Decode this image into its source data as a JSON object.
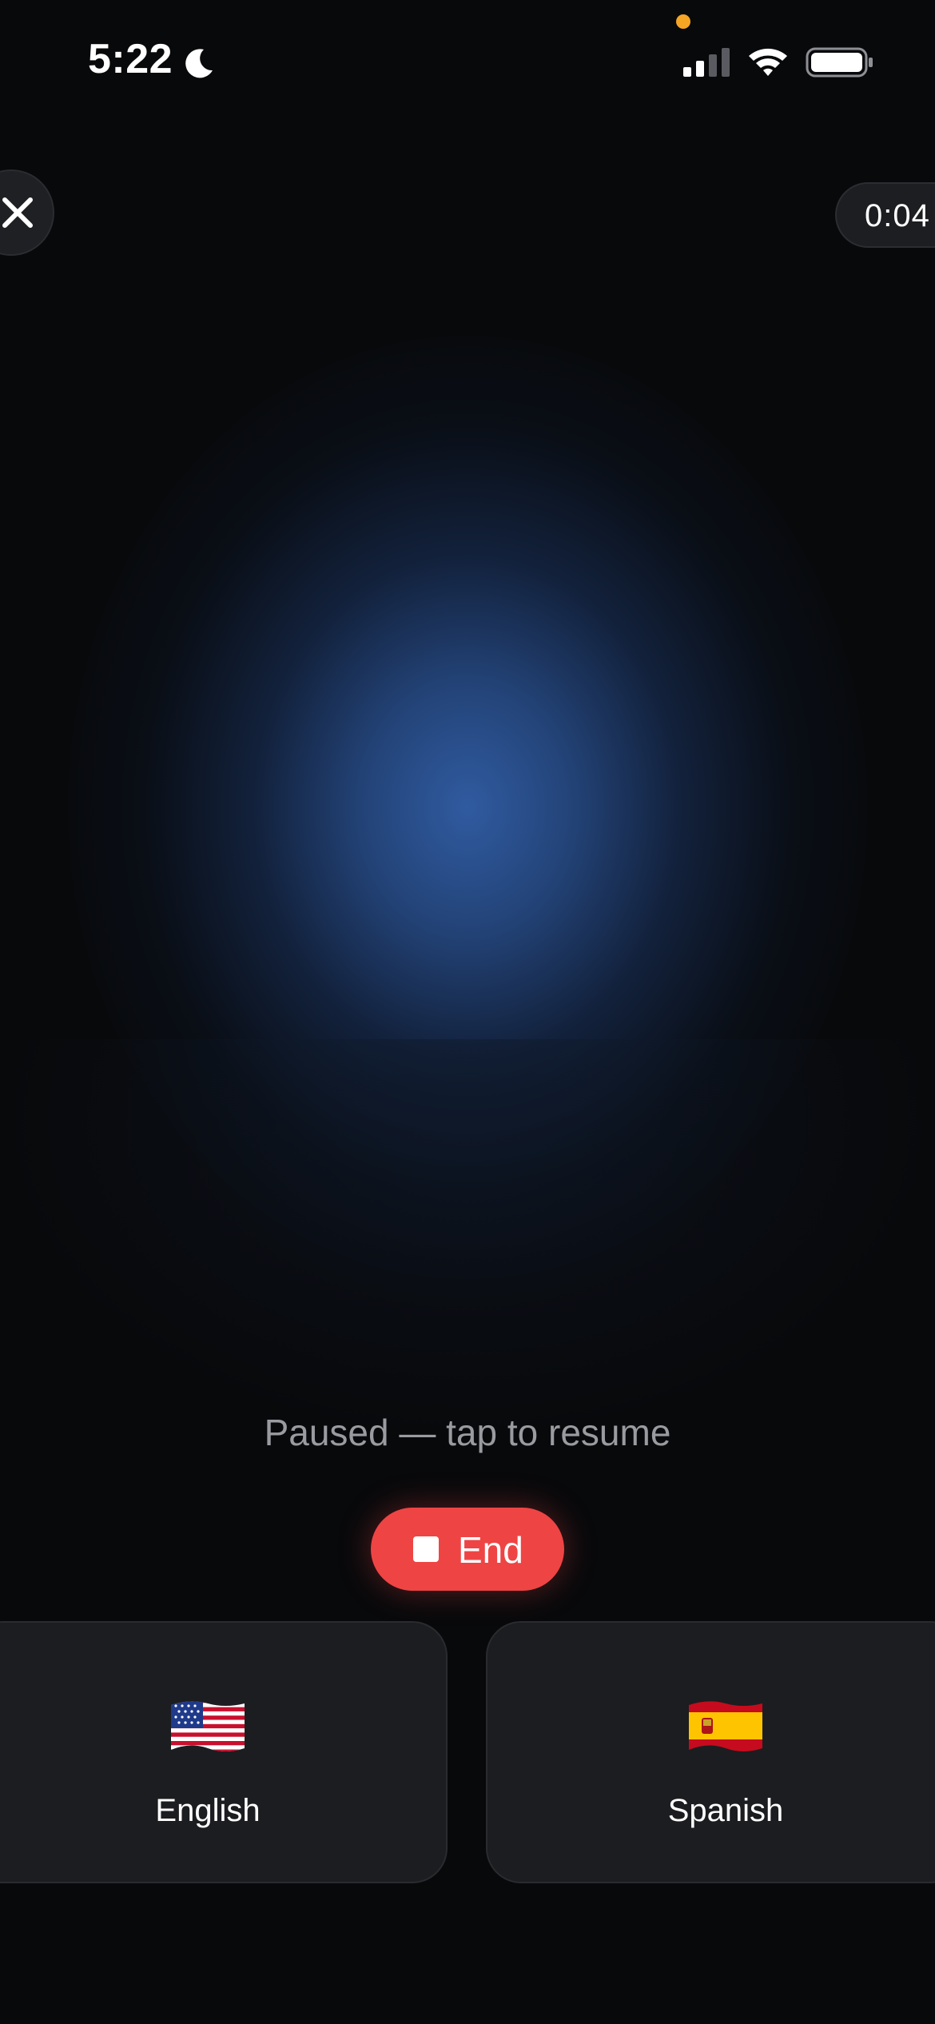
{
  "status_bar": {
    "time": "5:22",
    "moon_icon": "moon-icon",
    "signal_icon": "cellular-signal-icon",
    "wifi_icon": "wifi-icon",
    "battery_icon": "battery-icon",
    "mic_indicator_color": "#f5a524"
  },
  "header": {
    "close_icon": "close-icon",
    "timer": "0:04"
  },
  "session": {
    "status_message": "Paused — tap to resume",
    "end_label": "End",
    "end_icon": "stop-icon",
    "end_color": "#ef4444",
    "orb_color": "#305ba0"
  },
  "languages": [
    {
      "flag": "us-flag-icon",
      "label": "English"
    },
    {
      "flag": "spain-flag-icon",
      "label": "Spanish"
    }
  ]
}
